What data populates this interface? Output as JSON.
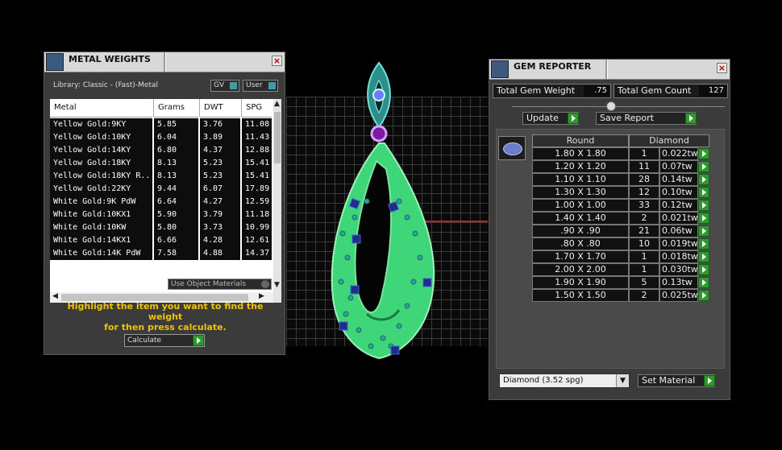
{
  "metal_weights": {
    "title": "METAL WEIGHTS",
    "library_label": "Library: Classic - (Fast)-Metal",
    "gv_label": "GV",
    "user_label": "User",
    "columns": [
      "Metal",
      "Grams",
      "DWT",
      "SPG"
    ],
    "rows": [
      {
        "metal": "Yellow Gold:9KY",
        "grams": "5.85",
        "dwt": "3.76",
        "spg": "11.08"
      },
      {
        "metal": "Yellow Gold:10KY",
        "grams": "6.04",
        "dwt": "3.89",
        "spg": "11.43"
      },
      {
        "metal": "Yellow Gold:14KY",
        "grams": "6.80",
        "dwt": "4.37",
        "spg": "12.88"
      },
      {
        "metal": "Yellow Gold:18KY",
        "grams": "8.13",
        "dwt": "5.23",
        "spg": "15.41"
      },
      {
        "metal": "Yellow Gold:18KY R...",
        "grams": "8.13",
        "dwt": "5.23",
        "spg": "15.41"
      },
      {
        "metal": "Yellow Gold:22KY",
        "grams": "9.44",
        "dwt": "6.07",
        "spg": "17.89"
      },
      {
        "metal": "White Gold:9K PdW",
        "grams": "6.64",
        "dwt": "4.27",
        "spg": "12.59"
      },
      {
        "metal": "White Gold:10KX1",
        "grams": "5.90",
        "dwt": "3.79",
        "spg": "11.18"
      },
      {
        "metal": "White Gold:10KW",
        "grams": "5.80",
        "dwt": "3.73",
        "spg": "10.99"
      },
      {
        "metal": "White Gold:14KX1",
        "grams": "6.66",
        "dwt": "4.28",
        "spg": "12.61"
      },
      {
        "metal": "White Gold:14K PdW",
        "grams": "7.58",
        "dwt": "4.88",
        "spg": "14.37"
      }
    ],
    "use_object_materials": "Use Object Materials",
    "hint_line1": "Highlight the item you want to find the weight",
    "hint_line2": "for then press calculate.",
    "calculate_label": "Calculate"
  },
  "gem_reporter": {
    "title": "GEM REPORTER",
    "total_weight_label": "Total Gem Weight",
    "total_weight_value": ".75",
    "total_count_label": "Total Gem Count",
    "total_count_value": "127",
    "update_label": "Update",
    "save_report_label": "Save Report",
    "col_round": "Round",
    "col_diamond": "Diamond",
    "rows": [
      {
        "size": "1.80 X 1.80",
        "count": "1",
        "weight": "0.022tw"
      },
      {
        "size": "1.20 X 1.20",
        "count": "11",
        "weight": "0.07tw"
      },
      {
        "size": "1.10 X 1.10",
        "count": "28",
        "weight": "0.14tw"
      },
      {
        "size": "1.30 X 1.30",
        "count": "12",
        "weight": "0.10tw"
      },
      {
        "size": "1.00 X 1.00",
        "count": "33",
        "weight": "0.12tw"
      },
      {
        "size": "1.40 X 1.40",
        "count": "2",
        "weight": "0.021tw"
      },
      {
        "size": ".90 X .90",
        "count": "21",
        "weight": "0.06tw"
      },
      {
        "size": ".80 X .80",
        "count": "10",
        "weight": "0.019tw"
      },
      {
        "size": "1.70 X 1.70",
        "count": "1",
        "weight": "0.018tw"
      },
      {
        "size": "2.00 X 2.00",
        "count": "1",
        "weight": "0.030tw"
      },
      {
        "size": "1.90 X 1.90",
        "count": "5",
        "weight": "0.13tw"
      },
      {
        "size": "1.50 X 1.50",
        "count": "2",
        "weight": "0.025tw"
      }
    ],
    "material_select": "Diamond     (3.52 spg)",
    "set_material_label": "Set Material"
  },
  "colors": {
    "hint": "#f2c200",
    "go_green": "#2e9a2e",
    "model_green": "#3fd67a",
    "gem_blue": "#1e2f8a"
  }
}
